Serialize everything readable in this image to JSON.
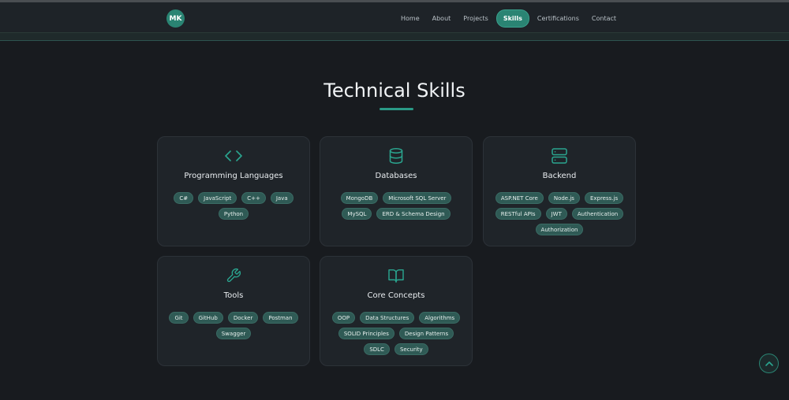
{
  "logo": {
    "text": "MK"
  },
  "nav": {
    "links": [
      {
        "label": "Home"
      },
      {
        "label": "About"
      },
      {
        "label": "Projects"
      },
      {
        "label": "Skills",
        "active": true
      },
      {
        "label": "Certifications"
      },
      {
        "label": "Contact"
      }
    ]
  },
  "section": {
    "title": "Technical Skills"
  },
  "cards": [
    {
      "title": "Programming Languages",
      "icon": "code-icon",
      "skills": [
        "C#",
        "JavaScript",
        "C++",
        "Java",
        "Python"
      ]
    },
    {
      "title": "Databases",
      "icon": "database-icon",
      "skills": [
        "MongoDB",
        "Microsoft SQL Server",
        "MySQL",
        "ERD & Schema Design"
      ]
    },
    {
      "title": "Backend",
      "icon": "server-icon",
      "skills": [
        "ASP.NET Core",
        "Node.js",
        "Express.js",
        "RESTful APIs",
        "JWT",
        "Authentication",
        "Authorization"
      ]
    },
    {
      "title": "Tools",
      "icon": "wrench-icon",
      "skills": [
        "Git",
        "GitHub",
        "Docker",
        "Postman",
        "Swagger"
      ]
    },
    {
      "title": "Core Concepts",
      "icon": "book-icon",
      "skills": [
        "OOP",
        "Data Structures",
        "Algorithms",
        "SOLID Principles",
        "Design Patterns",
        "SDLC",
        "Security"
      ]
    }
  ],
  "colors": {
    "accent": "#2a8473",
    "background": "#181b1f",
    "card": "#1f2429",
    "chip": "#2f5a55"
  },
  "scroll_top": {
    "icon": "chevron-up-icon"
  }
}
